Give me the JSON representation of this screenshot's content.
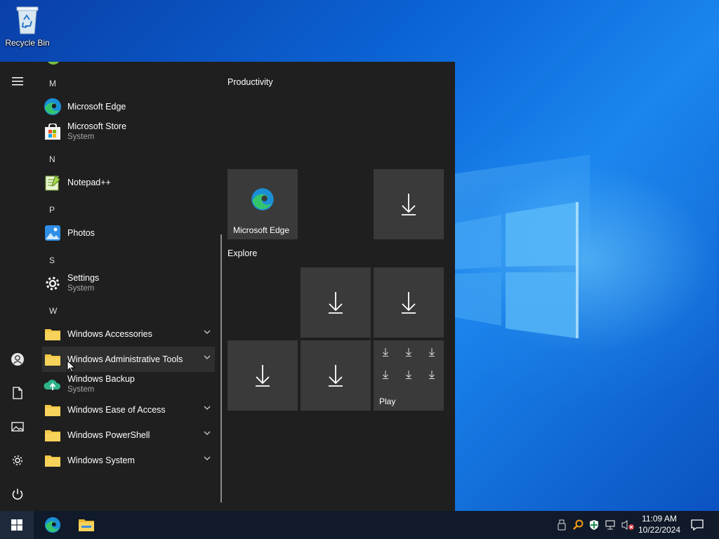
{
  "desktop": {
    "icons": [
      {
        "label": "Recycle Bin",
        "icon": "recycle-bin-icon"
      }
    ]
  },
  "start_menu": {
    "rail": [
      "hamburger-icon",
      "user-icon",
      "documents-icon",
      "pictures-icon",
      "gear-icon",
      "power-icon"
    ],
    "sections": [
      {
        "letter": "M",
        "apps": [
          {
            "name": "Microsoft Edge",
            "sub": ""
          },
          {
            "name": "Microsoft Store",
            "sub": "System"
          }
        ]
      },
      {
        "letter": "N",
        "apps": [
          {
            "name": "Notepad++",
            "sub": ""
          }
        ]
      },
      {
        "letter": "P",
        "apps": [
          {
            "name": "Photos",
            "sub": ""
          }
        ]
      },
      {
        "letter": "S",
        "apps": [
          {
            "name": "Settings",
            "sub": "System"
          }
        ]
      },
      {
        "letter": "W",
        "apps": [
          {
            "name": "Windows Accessories",
            "sub": ""
          },
          {
            "name": "Windows Administrative Tools",
            "sub": ""
          },
          {
            "name": "Windows Backup",
            "sub": "System"
          },
          {
            "name": "Windows Ease of Access",
            "sub": ""
          },
          {
            "name": "Windows PowerShell",
            "sub": ""
          },
          {
            "name": "Windows System",
            "sub": ""
          }
        ]
      }
    ],
    "groups": [
      {
        "title": "Productivity",
        "tiles": [
          {
            "label": "Microsoft Edge"
          },
          {
            "label": ""
          }
        ]
      },
      {
        "title": "Explore",
        "tiles": [
          {
            "label": ""
          },
          {
            "label": ""
          },
          {
            "label": ""
          },
          {
            "label": ""
          },
          {
            "label": "Play"
          }
        ]
      }
    ]
  },
  "taskbar": {
    "apps": [
      "microsoft-edge-icon",
      "file-explorer-icon"
    ],
    "tray": [
      "usb-icon",
      "search-tray-icon",
      "defender-icon",
      "network-icon",
      "volume-muted-icon"
    ],
    "time": "11:09 AM",
    "date": "10/22/2024"
  },
  "colors": {
    "start_bg": "#1f1f1f",
    "tile_bg": "#3a3a3a",
    "taskbar_bg": "#101a2a",
    "folder": "#f2c744"
  }
}
